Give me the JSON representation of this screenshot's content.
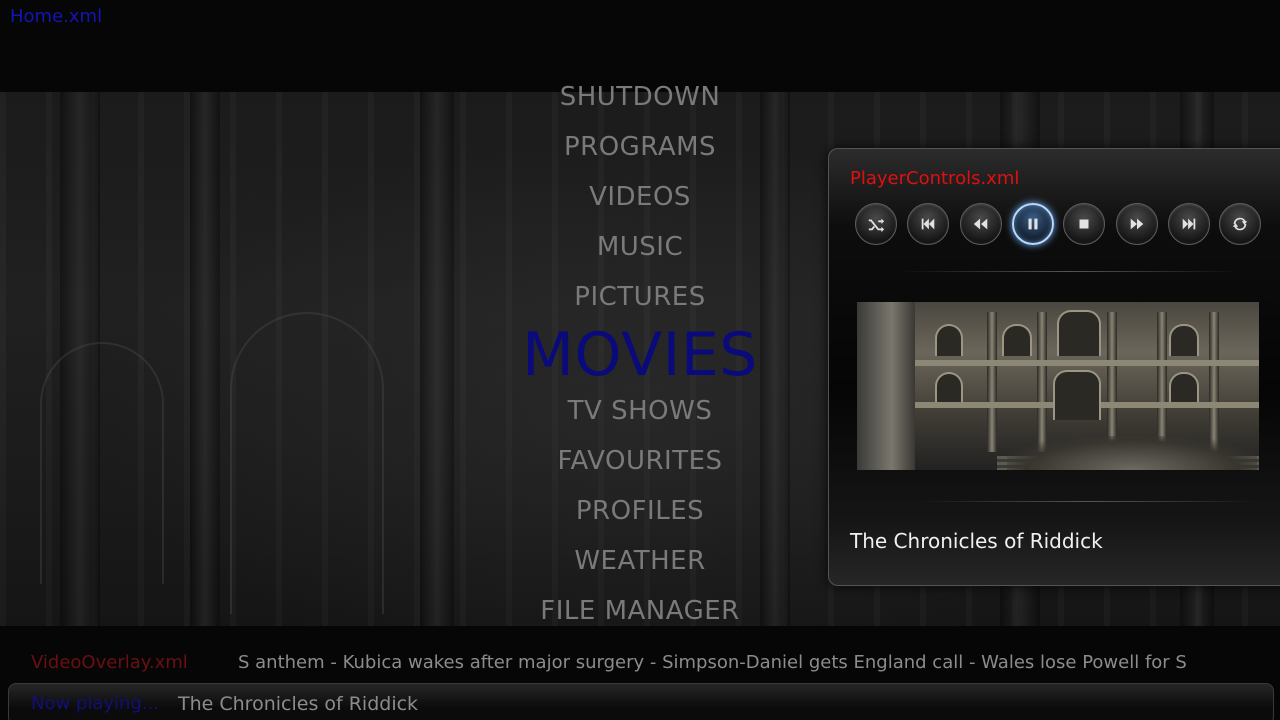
{
  "home": {
    "label": "Home.xml"
  },
  "menu": {
    "items": [
      {
        "label": "SHUTDOWN"
      },
      {
        "label": "PROGRAMS"
      },
      {
        "label": "VIDEOS"
      },
      {
        "label": "MUSIC"
      },
      {
        "label": "PICTURES"
      },
      {
        "label": "MOVIES"
      },
      {
        "label": "TV SHOWS"
      },
      {
        "label": "FAVOURITES"
      },
      {
        "label": "PROFILES"
      },
      {
        "label": "WEATHER"
      },
      {
        "label": "FILE MANAGER"
      }
    ],
    "focused_label": "MOVIES"
  },
  "player": {
    "title": "PlayerControls.xml",
    "controls": [
      {
        "icon": "shuffle-icon"
      },
      {
        "icon": "skip-previous-icon"
      },
      {
        "icon": "rewind-icon"
      },
      {
        "icon": "pause-icon",
        "active": true
      },
      {
        "icon": "stop-icon"
      },
      {
        "icon": "fast-forward-icon"
      },
      {
        "icon": "skip-next-icon"
      },
      {
        "icon": "repeat-icon"
      }
    ],
    "now_title": "The Chronicles of Riddick"
  },
  "overlay": {
    "label": "VideoOverlay.xml",
    "ticker": "S anthem - Kubica wakes after major surgery - Simpson-Daniel gets England call - Wales lose Powell for S",
    "now_playing_label": "Now playing...",
    "now_playing_title": "The Chronicles of Riddick"
  },
  "colors": {
    "focused_menu": "#0a0a7a",
    "panel_title": "#e01010",
    "overlay_label": "#6a1010",
    "now_playing_label": "#101078",
    "active_control_glow": "#6fb0ff"
  }
}
